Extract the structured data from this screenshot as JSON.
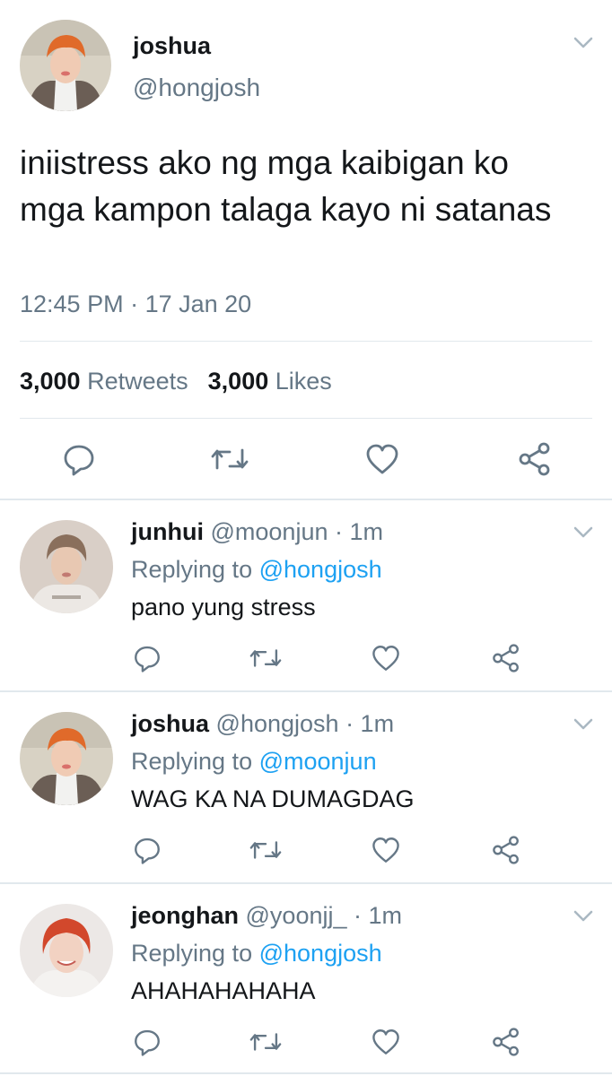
{
  "main_tweet": {
    "name": "joshua",
    "handle": "@hongjosh",
    "text": "iniistress ako ng mga kaibigan ko mga kampon talaga kayo ni satanas",
    "time": "12:45 PM",
    "separator": " · ",
    "date": "17 Jan 20",
    "retweets_count": "3,000",
    "retweets_label": "Retweets",
    "likes_count": "3,000",
    "likes_label": "Likes"
  },
  "replies": [
    {
      "name": "junhui",
      "handle": "@moonjun",
      "time": "· 1m",
      "replying_prefix": "Replying to",
      "replying_to": "@hongjosh",
      "text": "pano yung stress",
      "avatar_bg": "#d9cfc7",
      "hair": "#8a6f5c"
    },
    {
      "name": "joshua",
      "handle": "@hongjosh",
      "time": "· 1m",
      "replying_prefix": "Replying to",
      "replying_to": "@moonjun",
      "text": "WAG KA NA DUMAGDAG",
      "avatar_bg": "#d8d2c4",
      "hair": "#e06a2a"
    },
    {
      "name": "jeonghan",
      "handle": "@yoonjj_",
      "time": "· 1m",
      "replying_prefix": "Replying to",
      "replying_to": "@hongjosh",
      "text": "AHAHAHAHAHA",
      "avatar_bg": "#ece8e6",
      "hair": "#d2482c"
    }
  ],
  "icons": [
    "reply-icon",
    "retweet-icon",
    "like-icon",
    "share-icon",
    "chevron-down-icon"
  ],
  "colors": {
    "text": "#14171a",
    "secondary": "#657786",
    "link": "#1da1f2",
    "divider": "#e1e8ed"
  }
}
